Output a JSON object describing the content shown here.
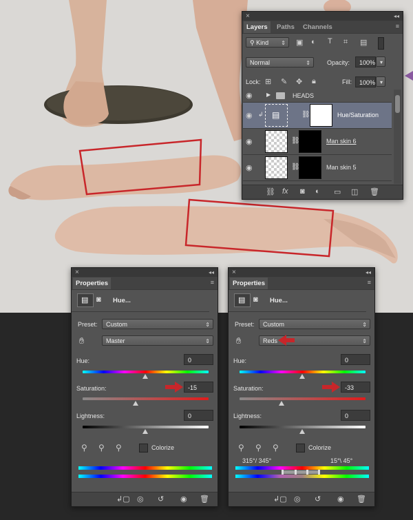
{
  "layers_panel": {
    "tabs": [
      "Layers",
      "Paths",
      "Channels"
    ],
    "filter_label": "Kind",
    "blend_mode": "Normal",
    "opacity_label": "Opacity:",
    "opacity_value": "100%",
    "lock_label": "Lock:",
    "fill_label": "Fill:",
    "fill_value": "100%",
    "layers": [
      {
        "name": "HEADS",
        "type": "group"
      },
      {
        "name": "Hue/Saturation",
        "type": "adjustment"
      },
      {
        "name": "Man skin 6",
        "type": "layer"
      },
      {
        "name": "Man skin 5",
        "type": "layer"
      }
    ]
  },
  "props_left": {
    "tab": "Properties",
    "adj_name": "Hue...",
    "preset_label": "Preset:",
    "preset_value": "Custom",
    "channel_value": "Master",
    "hue_label": "Hue:",
    "hue_value": "0",
    "sat_label": "Saturation:",
    "sat_value": "-15",
    "light_label": "Lightness:",
    "light_value": "0",
    "colorize_label": "Colorize"
  },
  "props_right": {
    "tab": "Properties",
    "adj_name": "Hue...",
    "preset_label": "Preset:",
    "preset_value": "Custom",
    "channel_value": "Reds",
    "hue_label": "Hue:",
    "hue_value": "0",
    "sat_label": "Saturation:",
    "sat_value": "-33",
    "light_label": "Lightness:",
    "light_value": "0",
    "colorize_label": "Colorize",
    "range_left": "315°/ 345°",
    "range_right": "15°\\ 45°"
  },
  "icons": {
    "close": "×",
    "collapse": "◂◂",
    "menu": "≡",
    "eye": "👁",
    "accent_red": "#c8262a"
  }
}
